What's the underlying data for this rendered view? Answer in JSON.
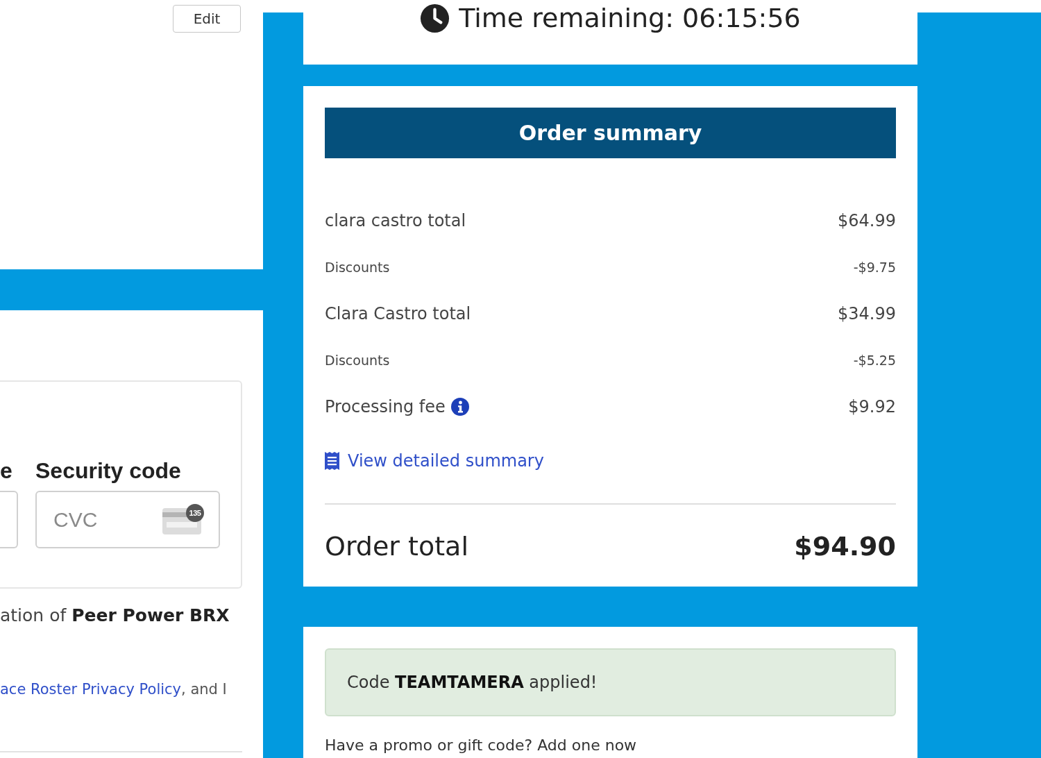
{
  "account_panel": {
    "edit_button": "Edit"
  },
  "payment_panel": {
    "expiry_label": "e",
    "security_code": {
      "label": "Security code",
      "placeholder": "CVC",
      "card_badge": "135"
    },
    "agreement_text": "ation of **Peer Power BRX**",
    "privacy_text": {
      "link": "ace Roster Privacy Policy",
      "after": ", and I"
    }
  },
  "timer": {
    "text": "Time remaining: 06:15:56"
  },
  "order_summary": {
    "title": "Order summary",
    "lines": [
      {
        "kind": "item",
        "label": "clara castro total",
        "amount": "$64.99",
        "has_info": false
      },
      {
        "kind": "discount",
        "label": "Discounts",
        "amount": "-$9.75",
        "has_info": false
      },
      {
        "kind": "item",
        "label": "Clara Castro total",
        "amount": "$34.99",
        "has_info": false
      },
      {
        "kind": "discount",
        "label": "Discounts",
        "amount": "-$5.25",
        "has_info": false
      },
      {
        "kind": "item",
        "label": "Processing fee",
        "amount": "$9.92",
        "has_info": true
      }
    ],
    "detail_link": "View detailed summary",
    "order_total": {
      "label": "Order total",
      "amount": "$94.90"
    }
  },
  "promo": {
    "applied_message": "Code **TEAMTAMERA** applied!",
    "prompt": "Have a promo or gift code? Add one now"
  }
}
